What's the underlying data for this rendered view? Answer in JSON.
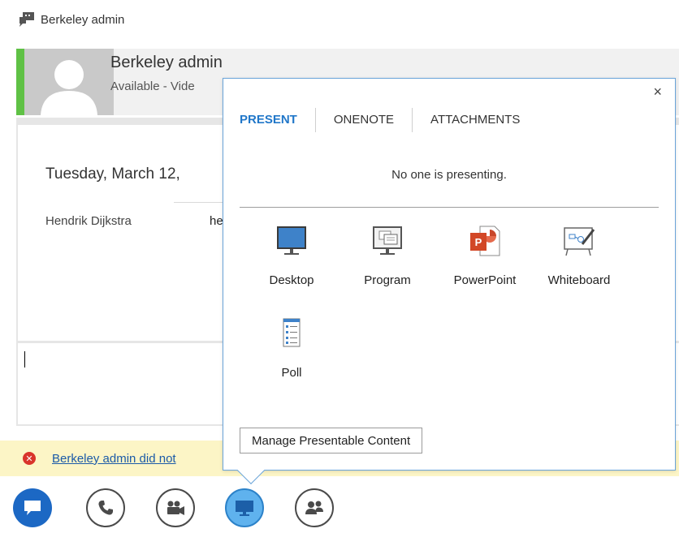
{
  "window": {
    "title": "Berkeley admin",
    "title_icon": "im-conversation-icon"
  },
  "contact": {
    "name": "Berkeley admin",
    "status": "Available - Vide",
    "presence_color": "#5fc145"
  },
  "conversation": {
    "date": "Tuesday, March 12, ",
    "messages": [
      {
        "sender": "Hendrik Dijkstra",
        "text": "he"
      }
    ]
  },
  "notification": {
    "icon": "error-icon",
    "text": "Berkeley admin did not "
  },
  "toolbar": {
    "buttons": [
      {
        "name": "im-button",
        "icon": "chat-bubble-icon"
      },
      {
        "name": "call-button",
        "icon": "phone-icon"
      },
      {
        "name": "video-button",
        "icon": "video-camera-icon"
      },
      {
        "name": "present-button",
        "icon": "monitor-icon",
        "active": true
      },
      {
        "name": "participants-button",
        "icon": "people-icon"
      }
    ]
  },
  "present_popup": {
    "close_label": "×",
    "tabs": [
      {
        "label": "PRESENT",
        "active": true
      },
      {
        "label": "ONENOTE",
        "active": false
      },
      {
        "label": "ATTACHMENTS",
        "active": false
      }
    ],
    "status": "No one is presenting.",
    "options": [
      {
        "label": "Desktop",
        "icon": "desktop-icon"
      },
      {
        "label": "Program",
        "icon": "program-icon"
      },
      {
        "label": "PowerPoint",
        "icon": "powerpoint-icon"
      },
      {
        "label": "Whiteboard",
        "icon": "whiteboard-icon"
      },
      {
        "label": "Poll",
        "icon": "poll-icon"
      }
    ],
    "manage_button": "Manage Presentable Content"
  },
  "colors": {
    "accent": "#2177c9",
    "presence_available": "#5fc145",
    "notification_bg": "#fcf5c6",
    "error": "#d9342b",
    "link": "#1b5aa8"
  }
}
